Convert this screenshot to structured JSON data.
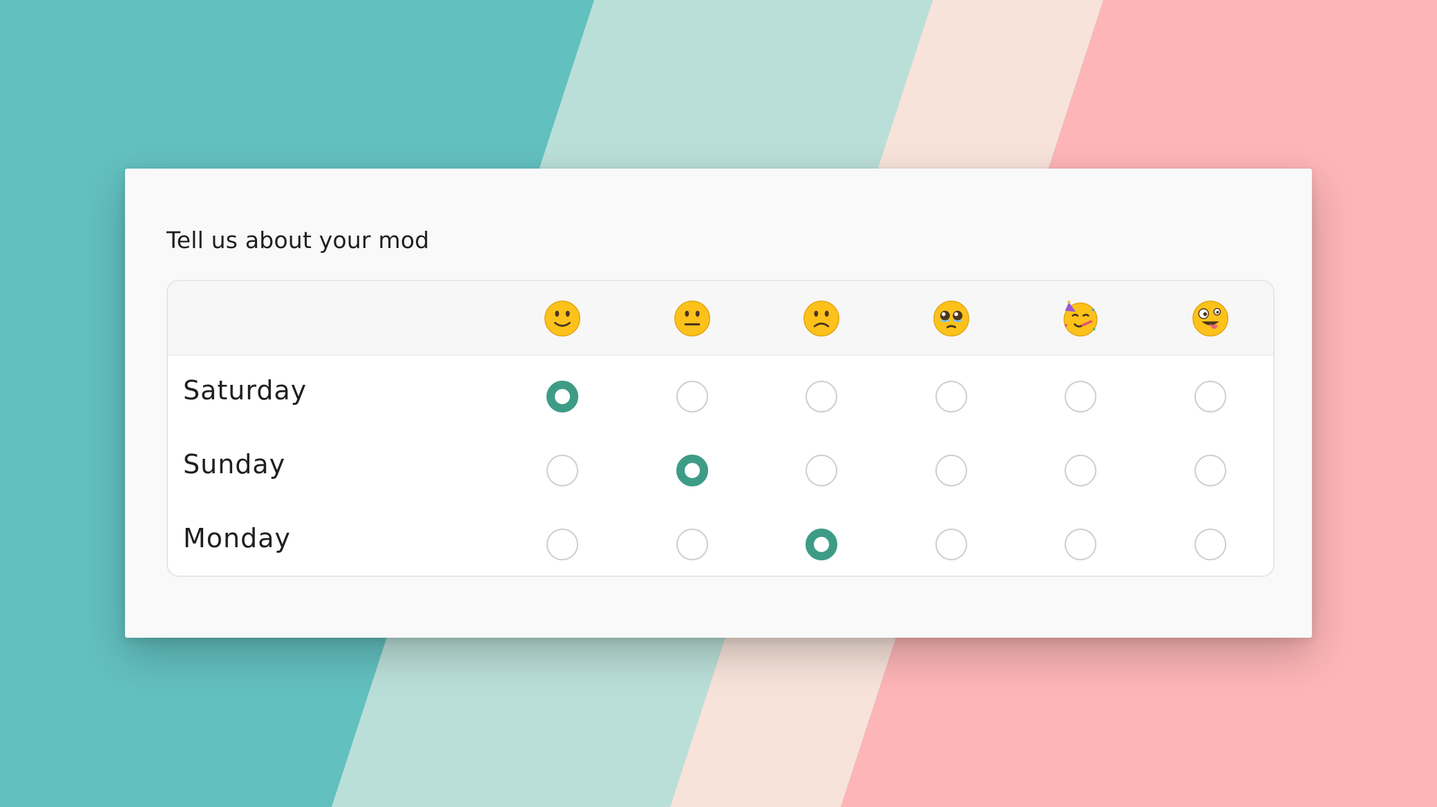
{
  "colors": {
    "teal": "#62c0bf",
    "mint": "#badfd8",
    "peach": "#f7e3da",
    "pink": "#fdb5b7",
    "accent": "#3e9c86"
  },
  "form": {
    "title": "Tell us about your mod",
    "columns": [
      {
        "icon": "slightly-smiling-face-icon"
      },
      {
        "icon": "neutral-face-icon"
      },
      {
        "icon": "slightly-frowning-face-icon"
      },
      {
        "icon": "pleading-face-icon"
      },
      {
        "icon": "partying-face-icon"
      },
      {
        "icon": "zany-face-icon"
      }
    ],
    "rows": [
      {
        "label": "Saturday",
        "selected": 0
      },
      {
        "label": "Sunday",
        "selected": 1
      },
      {
        "label": "Monday",
        "selected": 2
      }
    ]
  }
}
